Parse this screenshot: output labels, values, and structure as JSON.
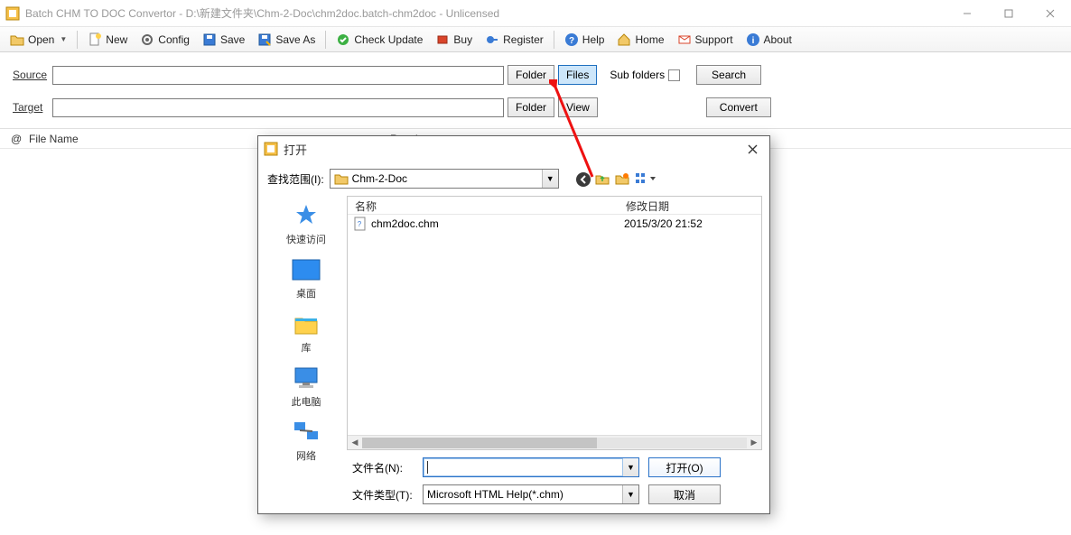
{
  "window": {
    "title": "Batch CHM TO DOC Convertor - D:\\新建文件夹\\Chm-2-Doc\\chm2doc.batch-chm2doc - Unlicensed"
  },
  "toolbar": {
    "open": "Open",
    "new": "New",
    "config": "Config",
    "save": "Save",
    "saveas": "Save As",
    "check": "Check Update",
    "buy": "Buy",
    "register": "Register",
    "help": "Help",
    "home": "Home",
    "support": "Support",
    "about": "About"
  },
  "paths": {
    "source_label": "Source",
    "target_label": "Target",
    "source_value": "",
    "target_value": "",
    "folder_btn": "Folder",
    "files_btn": "Files",
    "view_btn": "View",
    "sub_label": "Sub folders",
    "search_btn": "Search",
    "convert_btn": "Convert"
  },
  "list": {
    "col_at": "@",
    "col_file": "File Name",
    "col_result": "Result"
  },
  "dialog": {
    "title": "打开",
    "look_in_label": "查找范围(I):",
    "look_in_value": "Chm-2-Doc",
    "sidebar": {
      "quick": "快速访问",
      "desktop": "桌面",
      "lib": "库",
      "pc": "此电脑",
      "net": "网络"
    },
    "cols": {
      "name": "名称",
      "date": "修改日期"
    },
    "file": {
      "name": "chm2doc.chm",
      "date": "2015/3/20 21:52"
    },
    "filename_label": "文件名(N):",
    "filename_value": "",
    "filetype_label": "文件类型(T):",
    "filetype_value": "Microsoft HTML Help(*.chm)",
    "open_btn": "打开(O)",
    "cancel_btn": "取消"
  }
}
